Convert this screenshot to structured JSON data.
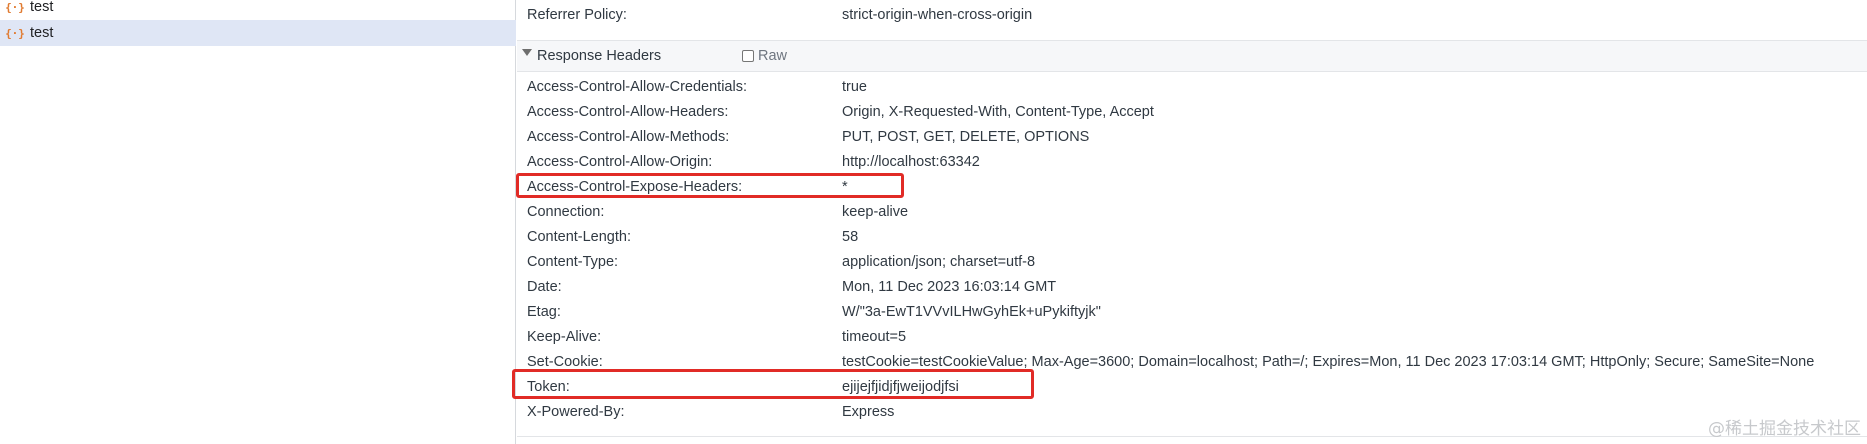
{
  "request_list": [
    {
      "icon": "{·}",
      "name": "test",
      "selected": false
    },
    {
      "icon": "{·}",
      "name": "test",
      "selected": true
    }
  ],
  "general": {
    "referrer_policy_key": "Referrer Policy:",
    "referrer_policy_value": "strict-origin-when-cross-origin"
  },
  "response_headers": {
    "title": "Response Headers",
    "raw_label": "Raw",
    "rows": [
      {
        "key": "Access-Control-Allow-Credentials:",
        "value": "true"
      },
      {
        "key": "Access-Control-Allow-Headers:",
        "value": "Origin, X-Requested-With, Content-Type, Accept"
      },
      {
        "key": "Access-Control-Allow-Methods:",
        "value": "PUT, POST, GET, DELETE, OPTIONS"
      },
      {
        "key": "Access-Control-Allow-Origin:",
        "value": "http://localhost:63342"
      },
      {
        "key": "Access-Control-Expose-Headers:",
        "value": "*"
      },
      {
        "key": "Connection:",
        "value": "keep-alive"
      },
      {
        "key": "Content-Length:",
        "value": "58"
      },
      {
        "key": "Content-Type:",
        "value": "application/json; charset=utf-8"
      },
      {
        "key": "Date:",
        "value": "Mon, 11 Dec 2023 16:03:14 GMT"
      },
      {
        "key": "Etag:",
        "value": "W/\"3a-EwT1VVvILHwGyhEk+uPykiftyjk\""
      },
      {
        "key": "Keep-Alive:",
        "value": "timeout=5"
      },
      {
        "key": "Set-Cookie:",
        "value": "testCookie=testCookieValue; Max-Age=3600; Domain=localhost; Path=/; Expires=Mon, 11 Dec 2023 17:03:14 GMT; HttpOnly; Secure; SameSite=None"
      },
      {
        "key": "Token:",
        "value": "ejijejfjidjfjweijodjfsi"
      },
      {
        "key": "X-Powered-By:",
        "value": "Express"
      }
    ]
  },
  "watermark": "@稀土掘金技术社区",
  "colors": {
    "highlight": "#e12b26",
    "selected_row": "#dfe6f5",
    "icon": "#e0792e"
  }
}
